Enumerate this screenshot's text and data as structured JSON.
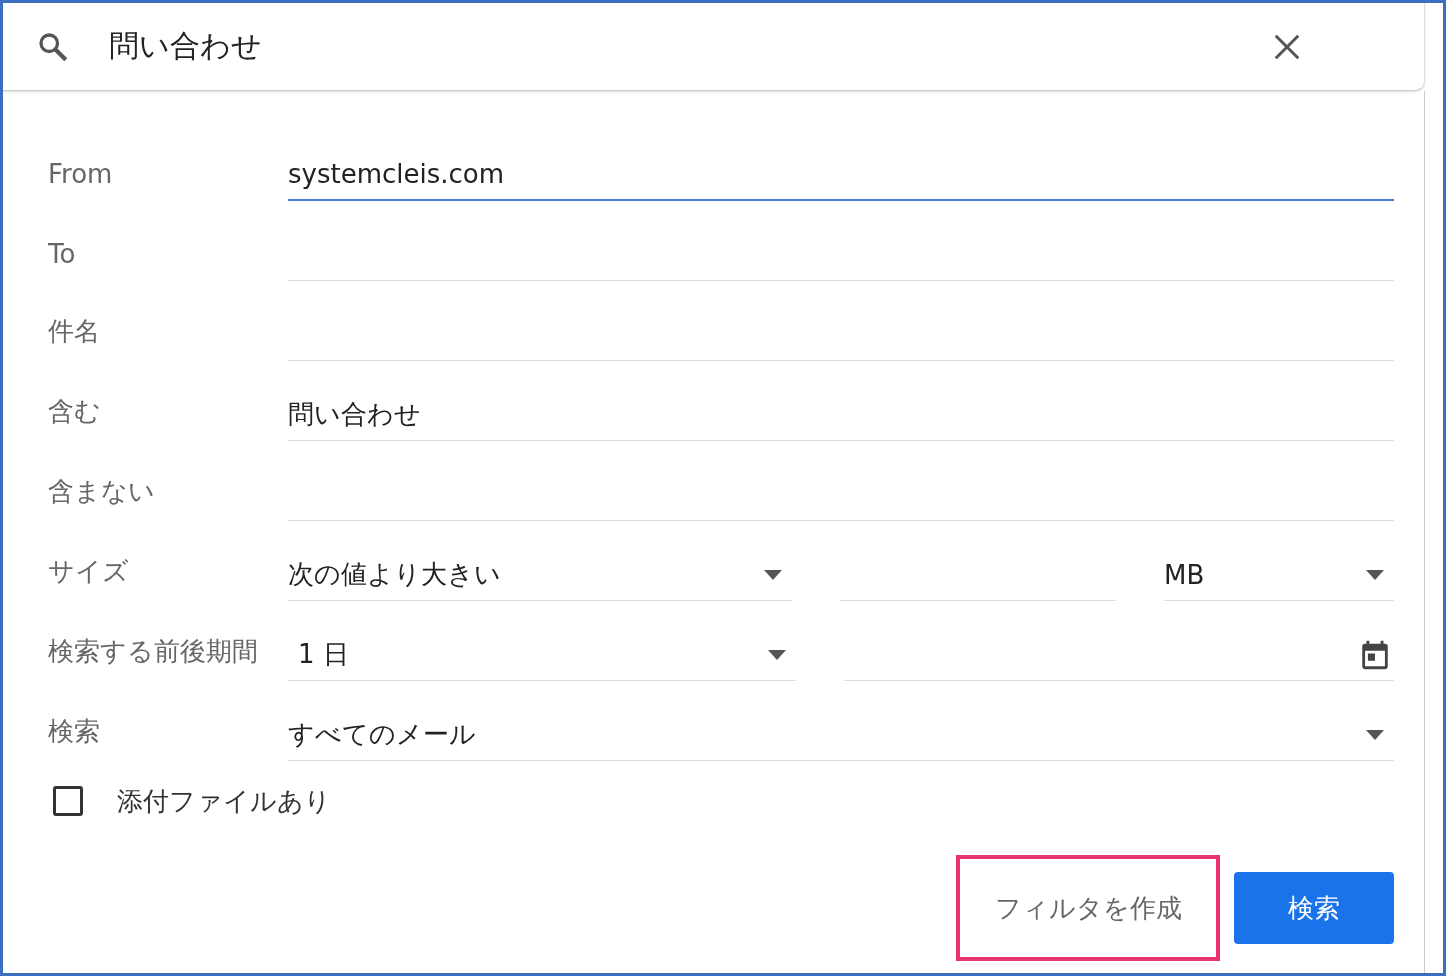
{
  "search": {
    "query": "問い合わせ"
  },
  "fields": [
    {
      "kind": "text",
      "label": "From",
      "value": "systemcleis.com",
      "focused": true
    },
    {
      "kind": "text",
      "label": "To",
      "focused": false
    },
    {
      "kind": "text",
      "label": "件名",
      "focused": false
    },
    {
      "kind": "text",
      "label": "含む",
      "value": "問い合わせ",
      "focused": false
    },
    {
      "kind": "text",
      "label": "含まない",
      "focused": false
    },
    {
      "kind": "size",
      "label": "サイズ",
      "comparator": "次の値より大きい",
      "unit": "MB"
    },
    {
      "kind": "date",
      "label": "検索する前後期間",
      "range": "1 日"
    },
    {
      "kind": "select",
      "label": "検索",
      "value": "すべてのメール"
    }
  ],
  "attachment": {
    "label": "添付ファイルあり",
    "checked": false
  },
  "buttons": {
    "create_filter": {
      "label": "フィルタを作成",
      "highlighted": true
    },
    "search": {
      "label": "検索"
    }
  }
}
